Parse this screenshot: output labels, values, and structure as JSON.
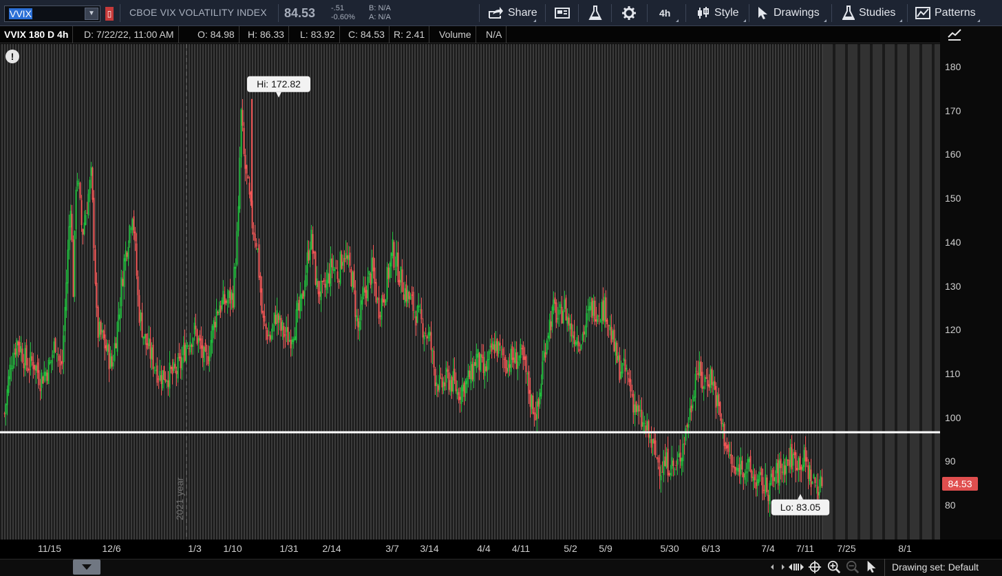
{
  "toolbar": {
    "symbol": "VVIX",
    "description": "CBOE VIX VOLATILITY INDEX",
    "last": "84.53",
    "net_change": "-.51",
    "pct_change": "-0.60%",
    "bid": "B: N/A",
    "ask": "A: N/A",
    "buttons": {
      "share": "Share",
      "aggregation": "4h",
      "style": "Style",
      "drawings": "Drawings",
      "studies": "Studies",
      "patterns": "Patterns"
    },
    "icons": [
      "share-icon",
      "flag-icon",
      "flask-icon",
      "gear-icon",
      "candle-style-icon",
      "cursor-icon",
      "studies-flask-icon",
      "patterns-icon"
    ]
  },
  "info_bar": {
    "study": "VVIX 180 D 4h",
    "date": "D: 7/22/22, 11:00 AM",
    "open": "O: 84.98",
    "high": "H: 86.33",
    "low": "L: 83.92",
    "close": "C: 84.53",
    "range": "R: 2.41",
    "volume_label": "Volume",
    "volume_value": "N/A"
  },
  "chart_data": {
    "type": "candlestick",
    "symbol": "VVIX",
    "aggregation": "4h",
    "period": "180 D",
    "ylim": [
      72,
      183
    ],
    "y_ticks": [
      80,
      90,
      100,
      110,
      120,
      130,
      140,
      150,
      160,
      170,
      180
    ],
    "x_ticks": [
      "11/15",
      "12/6",
      "1/3",
      "1/10",
      "1/31",
      "2/14",
      "3/7",
      "3/14",
      "4/4",
      "4/11",
      "5/2",
      "5/9",
      "5/30",
      "6/13",
      "7/4",
      "7/11",
      "7/25",
      "8/1"
    ],
    "year_marker": "2021 year",
    "high_label": "Hi: 172.82",
    "low_label": "Lo: 83.05",
    "last_price": "84.53",
    "horizontal_line": 96.8,
    "up_color": "#1fbe3c",
    "down_color": "#f05555",
    "path": [
      [
        "11/1",
        101
      ],
      [
        "11/3",
        113
      ],
      [
        "11/5",
        118
      ],
      [
        "11/8",
        112
      ],
      [
        "11/10",
        113
      ],
      [
        "11/12",
        109
      ],
      [
        "11/15",
        112
      ],
      [
        "11/17",
        118
      ],
      [
        "11/19",
        110
      ],
      [
        "11/22",
        150
      ],
      [
        "11/23",
        128
      ],
      [
        "11/24",
        158
      ],
      [
        "11/26",
        142
      ],
      [
        "11/29",
        155
      ],
      [
        "11/30",
        140
      ],
      [
        "12/1",
        120
      ],
      [
        "12/3",
        118
      ],
      [
        "12/6",
        112
      ],
      [
        "12/8",
        122
      ],
      [
        "12/10",
        135
      ],
      [
        "12/13",
        148
      ],
      [
        "12/15",
        125
      ],
      [
        "12/17",
        118
      ],
      [
        "12/20",
        113
      ],
      [
        "12/22",
        110
      ],
      [
        "12/27",
        110
      ],
      [
        "12/29",
        112
      ],
      [
        "12/31",
        117
      ],
      [
        "1/3",
        120
      ],
      [
        "1/5",
        112
      ],
      [
        "1/7",
        125
      ],
      [
        "1/10",
        128
      ],
      [
        "1/12",
        145
      ],
      [
        "1/13",
        170
      ],
      [
        "1/14",
        160
      ],
      [
        "1/17",
        145
      ],
      [
        "1/19",
        140
      ],
      [
        "1/21",
        122
      ],
      [
        "1/24",
        118
      ],
      [
        "1/26",
        124
      ],
      [
        "1/28",
        120
      ],
      [
        "1/31",
        118
      ],
      [
        "2/2",
        122
      ],
      [
        "2/4",
        126
      ],
      [
        "2/7",
        142
      ],
      [
        "2/9",
        130
      ],
      [
        "2/11",
        128
      ],
      [
        "2/14",
        135
      ],
      [
        "2/16",
        133
      ],
      [
        "2/18",
        138
      ],
      [
        "2/21",
        132
      ],
      [
        "2/23",
        120
      ],
      [
        "2/25",
        128
      ],
      [
        "2/28",
        134
      ],
      [
        "3/2",
        125
      ],
      [
        "3/4",
        128
      ],
      [
        "3/7",
        138
      ],
      [
        "3/9",
        130
      ],
      [
        "3/11",
        125
      ],
      [
        "3/14",
        118
      ],
      [
        "3/16",
        110
      ],
      [
        "3/18",
        107
      ],
      [
        "3/21",
        109
      ],
      [
        "3/23",
        108
      ],
      [
        "3/25",
        106
      ],
      [
        "3/28",
        108
      ],
      [
        "3/30",
        110
      ],
      [
        "4/1",
        114
      ],
      [
        "4/4",
        110
      ],
      [
        "4/6",
        117
      ],
      [
        "4/8",
        113
      ],
      [
        "4/11",
        114
      ],
      [
        "4/13",
        110
      ],
      [
        "4/15",
        104
      ],
      [
        "4/18",
        101
      ],
      [
        "4/20",
        112
      ],
      [
        "4/22",
        120
      ],
      [
        "4/25",
        125
      ],
      [
        "4/27",
        122
      ],
      [
        "4/29",
        126
      ],
      [
        "5/2",
        120
      ],
      [
        "5/4",
        118
      ],
      [
        "5/6",
        125
      ],
      [
        "5/9",
        125
      ],
      [
        "5/11",
        118
      ],
      [
        "5/13",
        112
      ],
      [
        "5/16",
        110
      ],
      [
        "5/18",
        104
      ],
      [
        "5/20",
        100
      ],
      [
        "5/23",
        96
      ],
      [
        "5/25",
        92
      ],
      [
        "5/27",
        89
      ],
      [
        "5/30",
        90
      ],
      [
        "6/1",
        88
      ],
      [
        "6/3",
        93
      ],
      [
        "6/6",
        102
      ],
      [
        "6/8",
        112
      ],
      [
        "6/10",
        108
      ],
      [
        "6/13",
        110
      ],
      [
        "6/15",
        104
      ],
      [
        "6/17",
        98
      ],
      [
        "6/20",
        90
      ],
      [
        "6/22",
        87
      ],
      [
        "6/24",
        90
      ],
      [
        "6/27",
        88
      ],
      [
        "6/29",
        86
      ],
      [
        "7/1",
        85
      ],
      [
        "7/4",
        84
      ],
      [
        "7/6",
        88
      ],
      [
        "7/8",
        91
      ],
      [
        "7/11",
        90
      ],
      [
        "7/13",
        88
      ],
      [
        "7/15",
        86
      ],
      [
        "7/18",
        85
      ],
      [
        "7/20",
        84
      ],
      [
        "7/22",
        84.53
      ]
    ]
  },
  "status_bar": {
    "drawing_set": "Drawing set: Default"
  }
}
